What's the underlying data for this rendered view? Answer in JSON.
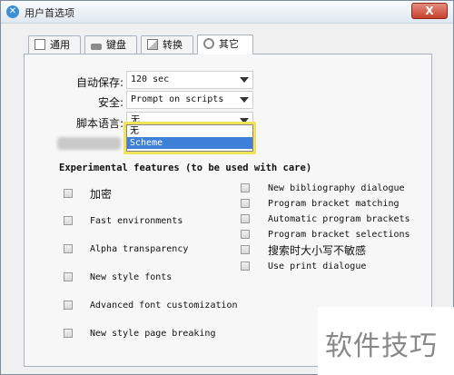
{
  "window": {
    "title": "用户首选项",
    "close_label": "X"
  },
  "tabs": [
    {
      "label": "通用",
      "icon": "general-icon"
    },
    {
      "label": "键盘",
      "icon": "keyboard-icon"
    },
    {
      "label": "转换",
      "icon": "convert-icon"
    },
    {
      "label": "其它",
      "icon": "gear-icon",
      "active": true
    }
  ],
  "fields": {
    "autosave": {
      "label": "自动保存:",
      "value": "120 sec"
    },
    "security": {
      "label": "安全:",
      "value": "Prompt on scripts"
    },
    "script_lang": {
      "label": "脚本语言:",
      "value": "无"
    }
  },
  "dropdown": {
    "options": [
      "无",
      "Scheme"
    ],
    "highlighted": "Scheme"
  },
  "experimental": {
    "title": "Experimental features (to be used with care)",
    "left": [
      "加密",
      "Fast environments",
      "Alpha transparency",
      "New style fonts",
      "Advanced font customization",
      "New style page breaking"
    ],
    "right": [
      "New bibliography dialogue",
      "Program bracket matching",
      "Automatic program brackets",
      "Program bracket selections",
      "搜索时大小写不敏感",
      "Use print dialogue"
    ]
  },
  "watermark": {
    "text": "软件技巧"
  }
}
